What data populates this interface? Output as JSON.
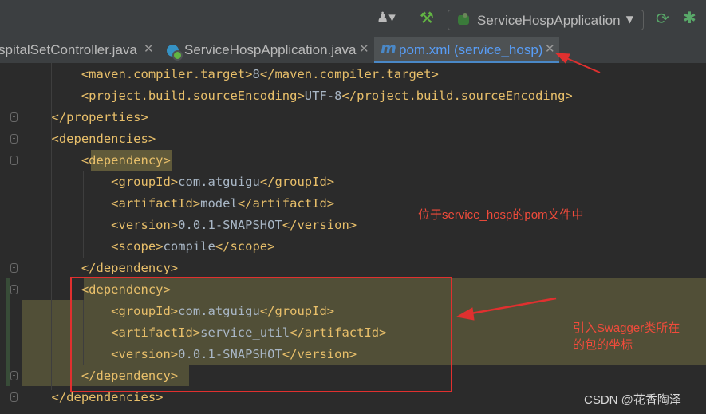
{
  "toolbar": {
    "run_config_label": "ServiceHospApplication"
  },
  "tabs": [
    {
      "label": "spitalSetController.java",
      "active": false
    },
    {
      "label": "ServiceHospApplication.java",
      "active": false
    },
    {
      "label": "pom.xml (service_hosp)",
      "active": true
    }
  ],
  "code": {
    "lines": [
      {
        "indent": "        ",
        "open": "<maven.compiler.target>",
        "text": "8",
        "close": "</maven.compiler.target>"
      },
      {
        "indent": "        ",
        "open": "<project.build.sourceEncoding>",
        "text": "UTF-8",
        "close": "</project.build.sourceEncoding>"
      },
      {
        "indent": "    ",
        "open": "</properties>",
        "text": "",
        "close": ""
      },
      {
        "indent": "    ",
        "open": "<dependencies>",
        "text": "",
        "close": ""
      },
      {
        "indent": "        ",
        "open": "<dependency>",
        "text": "",
        "close": ""
      },
      {
        "indent": "            ",
        "open": "<groupId>",
        "text": "com.atguigu",
        "close": "</groupId>"
      },
      {
        "indent": "            ",
        "open": "<artifactId>",
        "text": "model",
        "close": "</artifactId>"
      },
      {
        "indent": "            ",
        "open": "<version>",
        "text": "0.0.1-SNAPSHOT",
        "close": "</version>"
      },
      {
        "indent": "            ",
        "open": "<scope>",
        "text": "compile",
        "close": "</scope>"
      },
      {
        "indent": "        ",
        "open": "</dependency>",
        "text": "",
        "close": ""
      },
      {
        "indent": "        ",
        "open": "<dependency>",
        "text": "",
        "close": ""
      },
      {
        "indent": "            ",
        "open": "<groupId>",
        "text": "com.atguigu",
        "close": "</groupId>"
      },
      {
        "indent": "            ",
        "open": "<artifactId>",
        "text": "service_util",
        "close": "</artifactId>"
      },
      {
        "indent": "            ",
        "open": "<version>",
        "text": "0.0.1-SNAPSHOT",
        "close": "</version>"
      },
      {
        "indent": "        ",
        "open": "</dependency>",
        "text": "",
        "close": ""
      },
      {
        "indent": "    ",
        "open": "</dependencies>",
        "text": "",
        "close": ""
      }
    ]
  },
  "annotations": {
    "note1": "位于service_hosp的pom文件中",
    "note2_line1": "引入Swagger类所在",
    "note2_line2": "的包的坐标"
  },
  "watermark": "CSDN @花香陶泽",
  "colors": {
    "editor_bg": "#2b2b2b",
    "tag": "#e8bf6a",
    "text": "#a9b7c6",
    "highlight": "#514f37",
    "annotation_red": "#f14b3b"
  }
}
